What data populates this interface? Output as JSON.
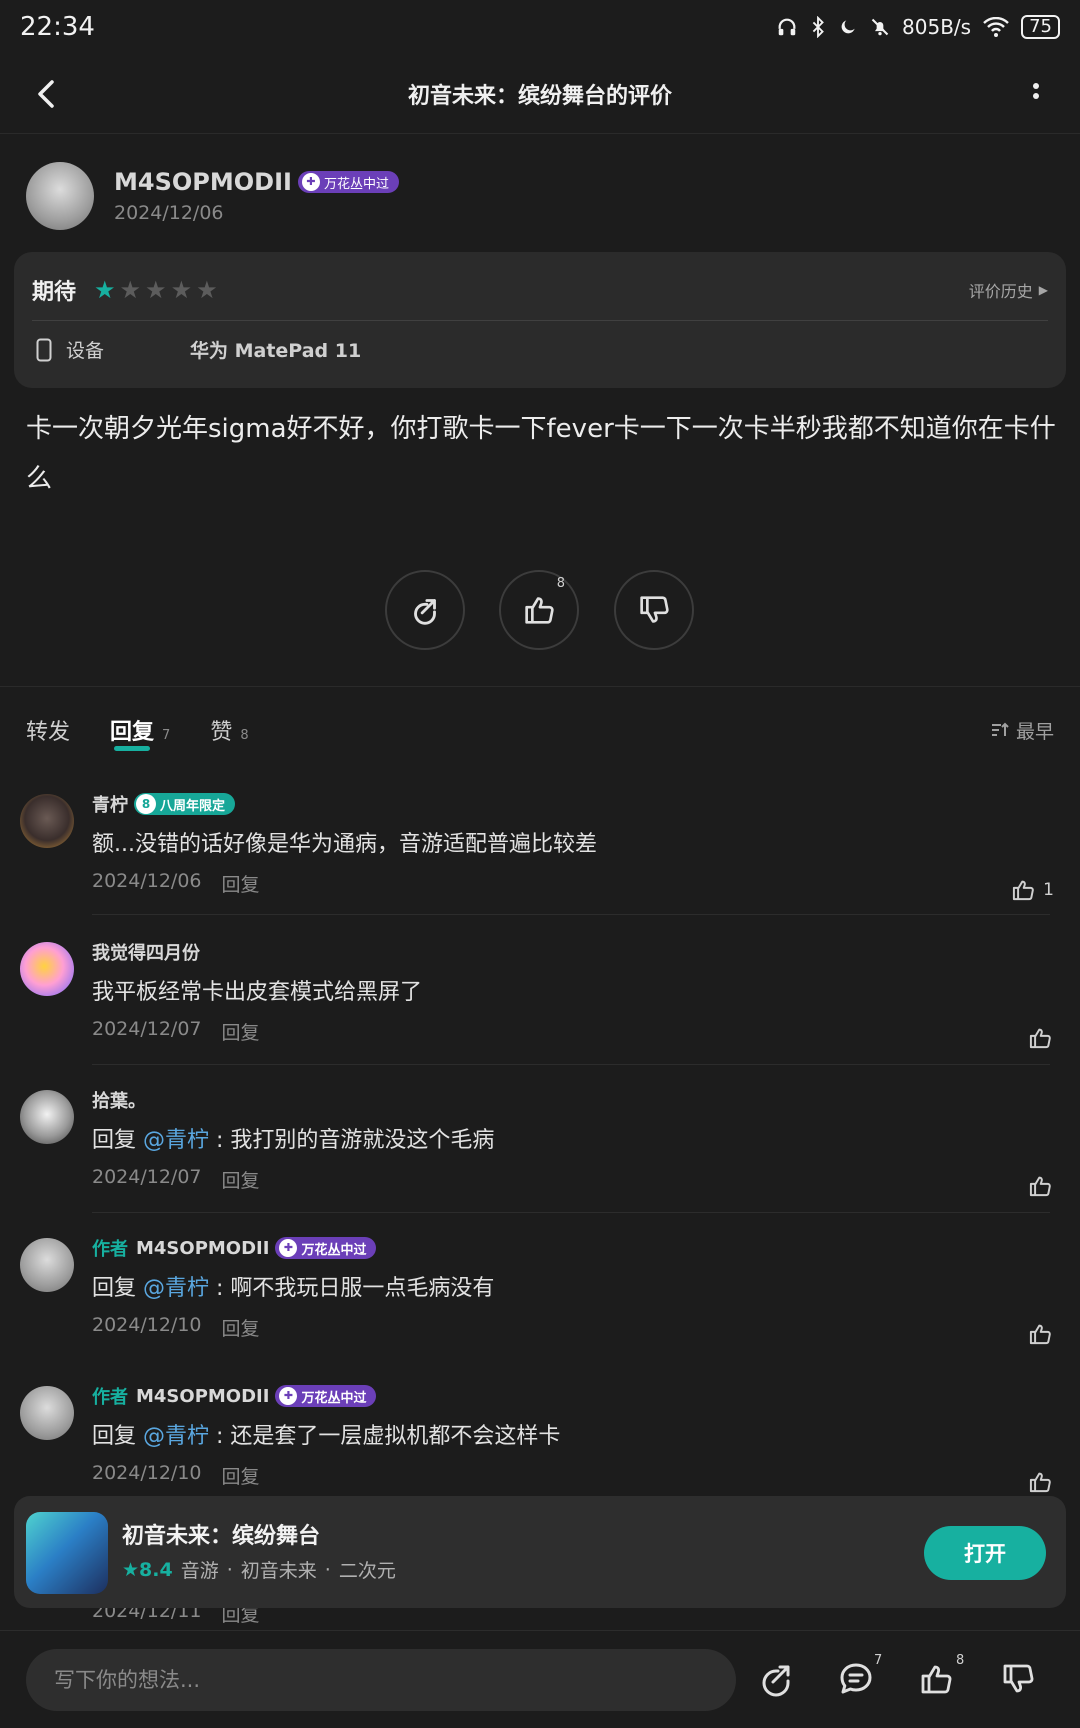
{
  "status_bar": {
    "time": "22:34",
    "network_speed": "805B/s",
    "battery": "75"
  },
  "header": {
    "title": "初音未来：缤纷舞台的评价"
  },
  "author": {
    "name": "M4SOPMODII",
    "badge": "万花丛中过",
    "date": "2024/12/06"
  },
  "rating_card": {
    "label": "期待",
    "stars": 1,
    "max_stars": 5,
    "history_label": "评价历史",
    "device_label": "设备",
    "device_value": "华为 MatePad 11"
  },
  "review_text": "卡一次朝夕光年sigma好不好，你打歌卡一下fever卡一下一次卡半秒我都不知道你在卡什么",
  "actions": {
    "like_count": "8"
  },
  "tabs": [
    {
      "label": "转发",
      "count": ""
    },
    {
      "label": "回复",
      "count": "7"
    },
    {
      "label": "赞",
      "count": "8"
    }
  ],
  "sort_label": "最早",
  "comments": [
    {
      "name": "青柠",
      "author_tag": "",
      "badge": "八周年限定",
      "badge_icon": "8",
      "reply_prefix": "",
      "mention": "",
      "text": "额...没错的话好像是华为通病，音游适配普遍比较差",
      "date": "2024/12/06",
      "reply_label": "回复",
      "likes": "1"
    },
    {
      "name": "我觉得四月份",
      "author_tag": "",
      "badge": "",
      "reply_prefix": "",
      "mention": "",
      "text": "我平板经常卡出皮套模式给黑屏了",
      "date": "2024/12/07",
      "reply_label": "回复",
      "likes": ""
    },
    {
      "name": "拾葉。",
      "author_tag": "",
      "badge": "",
      "reply_prefix": "回复",
      "mention": "@青柠",
      "text": " : 我打别的音游就没这个毛病",
      "date": "2024/12/07",
      "reply_label": "回复",
      "likes": ""
    },
    {
      "name": "M4SOPMODII",
      "author_tag": "作者",
      "badge": "万花丛中过",
      "reply_prefix": "回复",
      "mention": "@青柠",
      "text": " : 啊不我玩日服一点毛病没有",
      "date": "2024/12/10",
      "reply_label": "回复",
      "likes": ""
    },
    {
      "name": "M4SOPMODII",
      "author_tag": "作者",
      "badge": "万花丛中过",
      "reply_prefix": "回复",
      "mention": "@青柠",
      "text": " : 还是套了一层虚拟机都不会这样卡",
      "date": "2024/12/10",
      "reply_label": "回复",
      "likes": ""
    },
    {
      "date": "2024/12/11",
      "reply_label": "回复"
    }
  ],
  "app_bar": {
    "name": "初音未来：缤纷舞台",
    "score": "8.4",
    "tags": [
      "音游",
      "初音未来",
      "二次元"
    ],
    "open_label": "打开"
  },
  "bottom_bar": {
    "placeholder": "写下你的想法...",
    "comment_count": "7",
    "like_count": "8"
  },
  "colors": {
    "accent": "#17b0a0",
    "badge_purple": "#6b3fb8",
    "mention": "#5aa7e0",
    "background": "#1c1c1c"
  }
}
